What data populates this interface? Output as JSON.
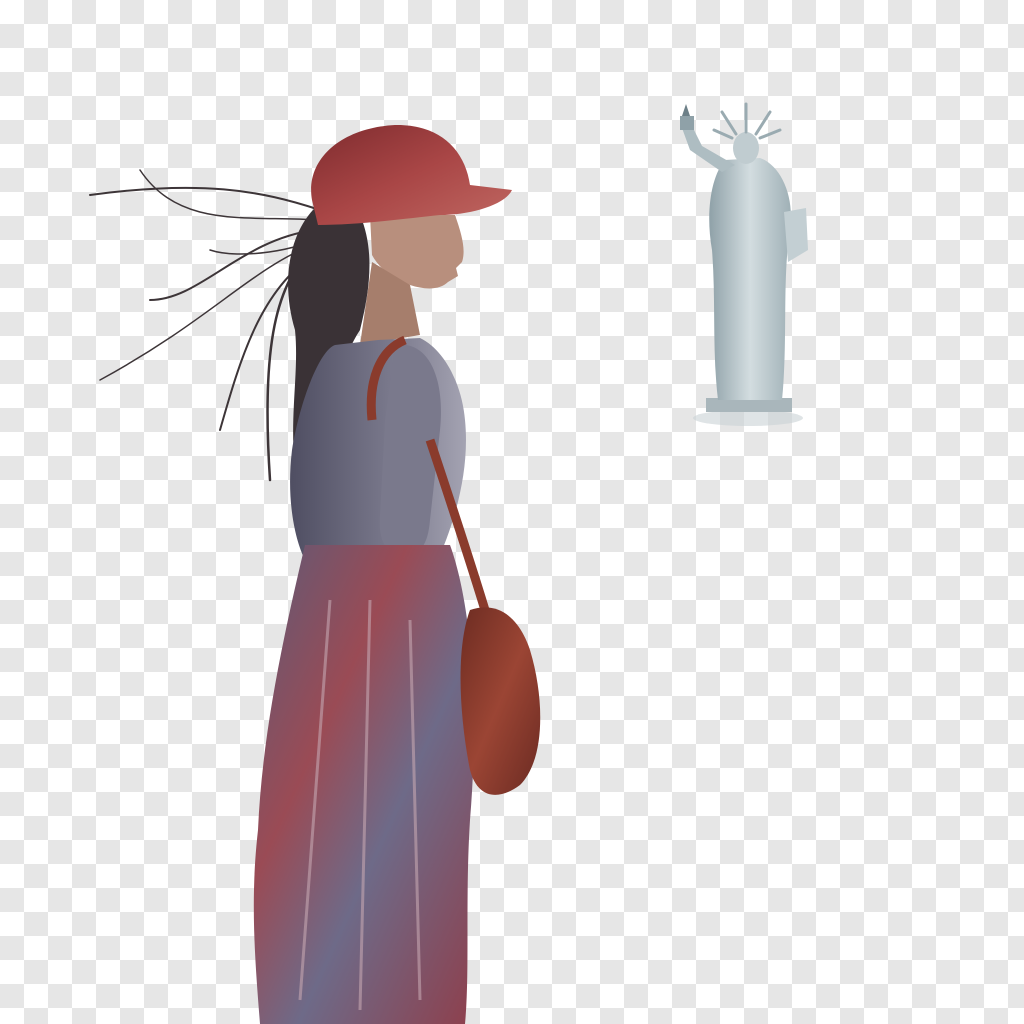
{
  "scene": {
    "background": "transparency-checkerboard",
    "subjects": [
      "woman-figure",
      "statue-of-liberty"
    ]
  },
  "colors": {
    "checker_light": "#ffffff",
    "checker_dark": "#e6e6e6",
    "cap_red": "#9b3a3a",
    "bag_brown": "#8a3b2c",
    "shirt_gray": "#6f6e80",
    "skirt_mauve": "#7a5363",
    "hair_dark": "#3a3236",
    "skin": "#b88f7d",
    "statue_patina": "#b9c7cc"
  }
}
